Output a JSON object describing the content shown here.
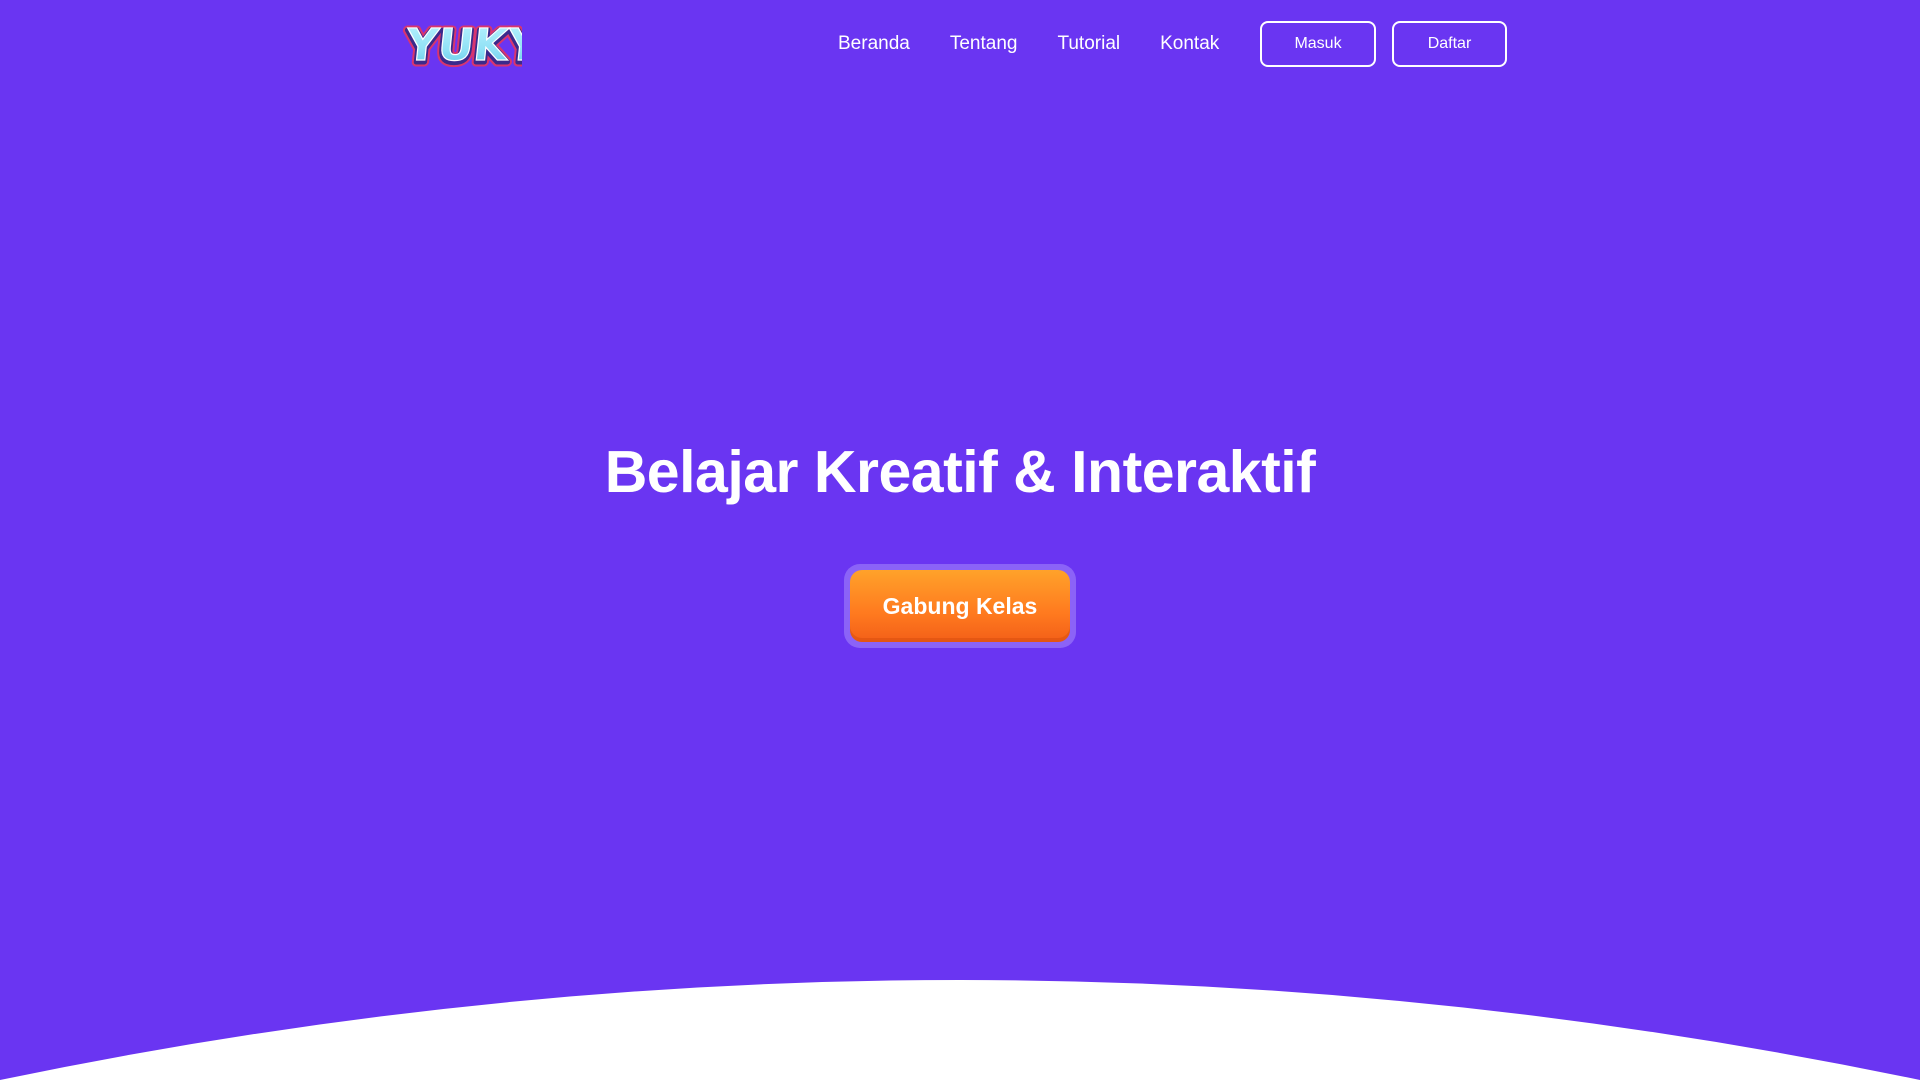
{
  "brand": {
    "logo_text": "YUKY"
  },
  "nav": {
    "links": [
      {
        "label": "Beranda"
      },
      {
        "label": "Tentang"
      },
      {
        "label": "Tutorial"
      },
      {
        "label": "Kontak"
      }
    ],
    "login_label": "Masuk",
    "register_label": "Daftar"
  },
  "hero": {
    "title": "Belajar Kreatif & Interaktif",
    "cta_label": "Gabung Kelas"
  },
  "colors": {
    "background": "#6a35f2",
    "cta_orange": "#ff7a1f",
    "cta_ring": "#8b63f7",
    "text": "#ffffff"
  }
}
